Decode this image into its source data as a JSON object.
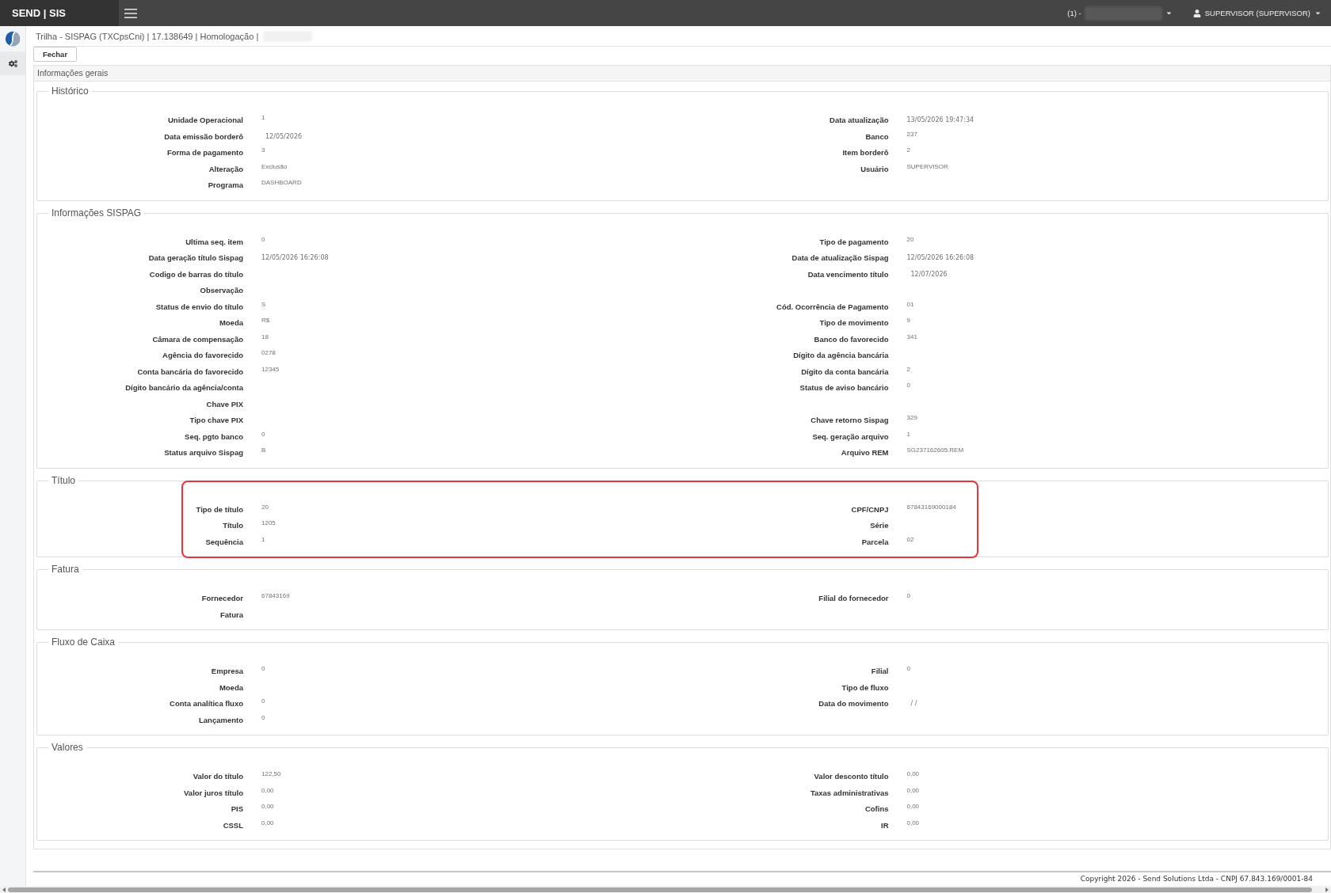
{
  "top_bar": {
    "brand": "SEND | SIS",
    "company_selector": "(1) -",
    "user_menu": "SUPERVISOR (SUPERVISOR)"
  },
  "header": {
    "title": "Trilha - SISPAG (TXCpsCni) | 17.138649 | Homologação |"
  },
  "toolbar": {
    "buttons": [
      "Fechar"
    ]
  },
  "panel": {
    "title": "Informações gerais",
    "sections": [
      {
        "title": "Histórico",
        "highlighted": false,
        "rows": [
          {
            "left": {
              "label": "Unidade Operacional",
              "value": "1",
              "kind": "text"
            },
            "right": {
              "label": "Data atualização",
              "value": "13/05/2026 19:47:34",
              "kind": "datetime"
            }
          },
          {
            "left": {
              "label": "Data emissão borderô",
              "value": "12/05/2026",
              "kind": "date"
            },
            "right": {
              "label": "Banco",
              "value": "237",
              "kind": "text"
            }
          },
          {
            "left": {
              "label": "Forma de pagamento",
              "value": "3",
              "kind": "text"
            },
            "right": {
              "label": "Item borderô",
              "value": "2",
              "kind": "text"
            }
          },
          {
            "left": {
              "label": "Alteração",
              "value": "Exclusão",
              "kind": "text"
            },
            "right": {
              "label": "Usuário",
              "value": "SUPERVISOR",
              "kind": "text"
            }
          },
          {
            "left": {
              "label": "Programa",
              "value": "DASHBOARD",
              "kind": "text"
            }
          }
        ]
      },
      {
        "title": "Informações SISPAG",
        "highlighted": false,
        "rows": [
          {
            "left": {
              "label": "Ultima seq. item",
              "value": "0",
              "kind": "text"
            },
            "right": {
              "label": "Tipo de pagamento",
              "value": "20",
              "kind": "text"
            }
          },
          {
            "left": {
              "label": "Data geração título Sispag",
              "value": "12/05/2026 16:26:08",
              "kind": "datetime"
            },
            "right": {
              "label": "Data de atualização Sispag",
              "value": "12/05/2026 16:26:08",
              "kind": "datetime"
            }
          },
          {
            "left": {
              "label": "Codigo de barras do título"
            },
            "right": {
              "label": "Data vencimento título",
              "value": "12/07/2026",
              "kind": "date"
            }
          },
          {
            "left": {
              "label": "Observação"
            }
          },
          {
            "left": {
              "label": "Status de envio do título",
              "value": "S",
              "kind": "text"
            },
            "right": {
              "label": "Cód. Ocorrência de Pagamento",
              "value": "01",
              "kind": "text"
            }
          },
          {
            "left": {
              "label": "Moeda",
              "value": "R$",
              "kind": "text"
            },
            "right": {
              "label": "Tipo de movimento",
              "value": "9",
              "kind": "text"
            }
          },
          {
            "left": {
              "label": "Câmara de compensação",
              "value": "18",
              "kind": "text"
            },
            "right": {
              "label": "Banco do favorecido",
              "value": "341",
              "kind": "text"
            }
          },
          {
            "left": {
              "label": "Agência do favorecido",
              "value": "0278",
              "kind": "text"
            },
            "right": {
              "label": "Dígito da agência bancária"
            }
          },
          {
            "left": {
              "label": "Conta bancária do favorecido",
              "value": "12345",
              "kind": "text"
            },
            "right": {
              "label": "Dígito da conta bancária",
              "value": "2",
              "kind": "text"
            }
          },
          {
            "left": {
              "label": "Dígito bancário da agência/conta"
            },
            "right": {
              "label": "Status de aviso bancário",
              "value": "0",
              "kind": "text"
            }
          },
          {
            "left": {
              "label": "Chave PIX"
            }
          },
          {
            "left": {
              "label": "Tipo chave PIX"
            },
            "right": {
              "label": "Chave retorno Sispag",
              "value": "329",
              "kind": "text"
            }
          },
          {
            "left": {
              "label": "Seq. pgto banco",
              "value": "0",
              "kind": "text"
            },
            "right": {
              "label": "Seq. geração arquivo",
              "value": "1",
              "kind": "text"
            }
          },
          {
            "left": {
              "label": "Status arquivo Sispag",
              "value": "B",
              "kind": "text"
            },
            "right": {
              "label": "Arquivo REM",
              "value": "SG237162605.REM",
              "kind": "text"
            }
          }
        ]
      },
      {
        "title": "Título",
        "highlighted": true,
        "rows": [
          {
            "left": {
              "label": "Tipo de título",
              "value": "20",
              "kind": "text"
            },
            "right": {
              "label": "CPF/CNPJ",
              "value": "67843169000184",
              "kind": "text"
            }
          },
          {
            "left": {
              "label": "Título",
              "value": "1205",
              "kind": "text"
            },
            "right": {
              "label": "Série"
            }
          },
          {
            "left": {
              "label": "Sequência",
              "value": "1",
              "kind": "text"
            },
            "right": {
              "label": "Parcela",
              "value": "02",
              "kind": "text"
            }
          }
        ]
      },
      {
        "title": "Fatura",
        "highlighted": false,
        "rows": [
          {
            "left": {
              "label": "Fornecedor",
              "value": "67843169",
              "kind": "text"
            },
            "right": {
              "label": "Filial do fornecedor",
              "value": "0",
              "kind": "text"
            }
          },
          {
            "left": {
              "label": "Fatura"
            }
          }
        ]
      },
      {
        "title": "Fluxo de Caixa",
        "highlighted": false,
        "rows": [
          {
            "left": {
              "label": "Empresa",
              "value": "0",
              "kind": "text"
            },
            "right": {
              "label": "Filial",
              "value": "0",
              "kind": "text"
            }
          },
          {
            "left": {
              "label": "Moeda"
            },
            "right": {
              "label": "Tipo de fluxo"
            }
          },
          {
            "left": {
              "label": "Conta analítica fluxo",
              "value": "0",
              "kind": "text"
            },
            "right": {
              "label": "Data do movimento",
              "value": "/ /",
              "kind": "date"
            }
          },
          {
            "left": {
              "label": "Lançamento",
              "value": "0",
              "kind": "text"
            }
          }
        ]
      },
      {
        "title": "Valores",
        "highlighted": false,
        "rows": [
          {
            "left": {
              "label": "Valor do título",
              "value": "122,50",
              "kind": "text"
            },
            "right": {
              "label": "Valor desconto título",
              "value": "0,00",
              "kind": "text"
            }
          },
          {
            "left": {
              "label": "Valor juros título",
              "value": "0,00",
              "kind": "text"
            },
            "right": {
              "label": "Taxas administrativas",
              "value": "0,00",
              "kind": "text"
            }
          },
          {
            "left": {
              "label": "PIS",
              "value": "0,00",
              "kind": "text"
            },
            "right": {
              "label": "Cofins",
              "value": "0,00",
              "kind": "text"
            }
          },
          {
            "left": {
              "label": "CSSL",
              "value": "0,00",
              "kind": "text"
            },
            "right": {
              "label": "IR",
              "value": "0,00",
              "kind": "text"
            }
          }
        ]
      }
    ]
  },
  "footer": {
    "copyright": "Copyright 2026 - Send Solutions Ltda - CNPJ 67.843.169/0001-84"
  }
}
